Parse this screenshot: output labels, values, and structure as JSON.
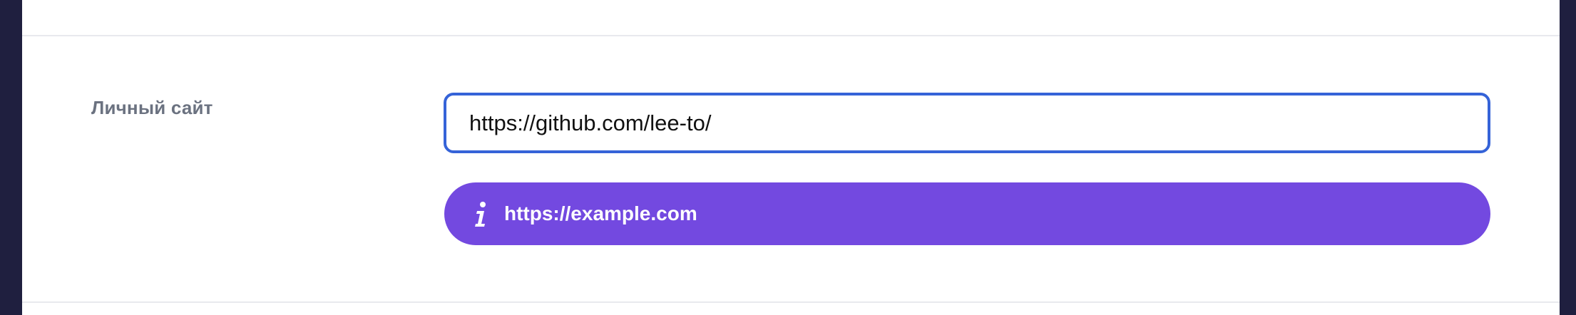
{
  "form_row": {
    "label": "Личный сайт",
    "input_value": "https://github.com/lee-to/",
    "hint_text": "https://example.com",
    "hint_icon": "info-icon"
  },
  "colors": {
    "sidebar_bg": "#1f1f3f",
    "panel_bg": "#ffffff",
    "input_border": "#3563d8",
    "hint_bg": "#7349e0",
    "label_color": "#6b7280"
  }
}
